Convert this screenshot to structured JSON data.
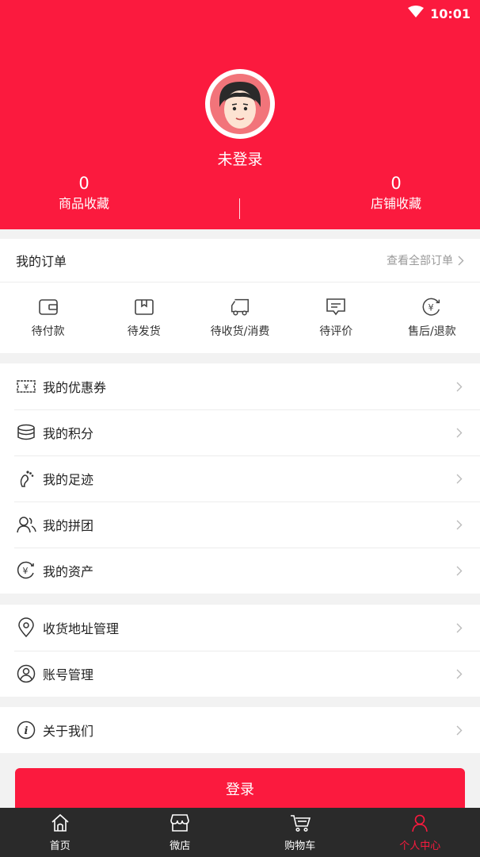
{
  "status_bar": {
    "time": "10:01"
  },
  "profile": {
    "login_status": "未登录",
    "stats": [
      {
        "value": "0",
        "label": "商品收藏"
      },
      {
        "value": "0",
        "label": "店铺收藏"
      }
    ]
  },
  "orders": {
    "title": "我的订单",
    "view_all": "查看全部订单",
    "items": [
      {
        "label": "待付款",
        "icon": "wallet-icon"
      },
      {
        "label": "待发货",
        "icon": "box-icon"
      },
      {
        "label": "待收货/消费",
        "icon": "truck-icon"
      },
      {
        "label": "待评价",
        "icon": "comment-icon"
      },
      {
        "label": "售后/退款",
        "icon": "refund-icon"
      }
    ]
  },
  "menu_groups": [
    [
      {
        "label": "我的优惠券",
        "icon": "coupon-icon"
      },
      {
        "label": "我的积分",
        "icon": "coins-icon"
      },
      {
        "label": "我的足迹",
        "icon": "footprint-icon"
      },
      {
        "label": "我的拼团",
        "icon": "group-icon"
      },
      {
        "label": "我的资产",
        "icon": "assets-icon"
      }
    ],
    [
      {
        "label": "收货地址管理",
        "icon": "location-pin-icon"
      },
      {
        "label": "账号管理",
        "icon": "user-circle-icon"
      }
    ],
    [
      {
        "label": "关于我们",
        "icon": "info-icon"
      }
    ]
  ],
  "login_button": "登录",
  "tabbar": {
    "items": [
      {
        "label": "首页",
        "icon": "home-icon"
      },
      {
        "label": "微店",
        "icon": "shop-icon"
      },
      {
        "label": "购物车",
        "icon": "cart-icon"
      },
      {
        "label": "个人中心",
        "icon": "person-icon"
      }
    ],
    "active": "个人中心"
  },
  "colors": {
    "brand_red": "#fb1a3e",
    "tabbar_bg": "#2a2a2a",
    "page_bg": "#f2f2f2"
  }
}
